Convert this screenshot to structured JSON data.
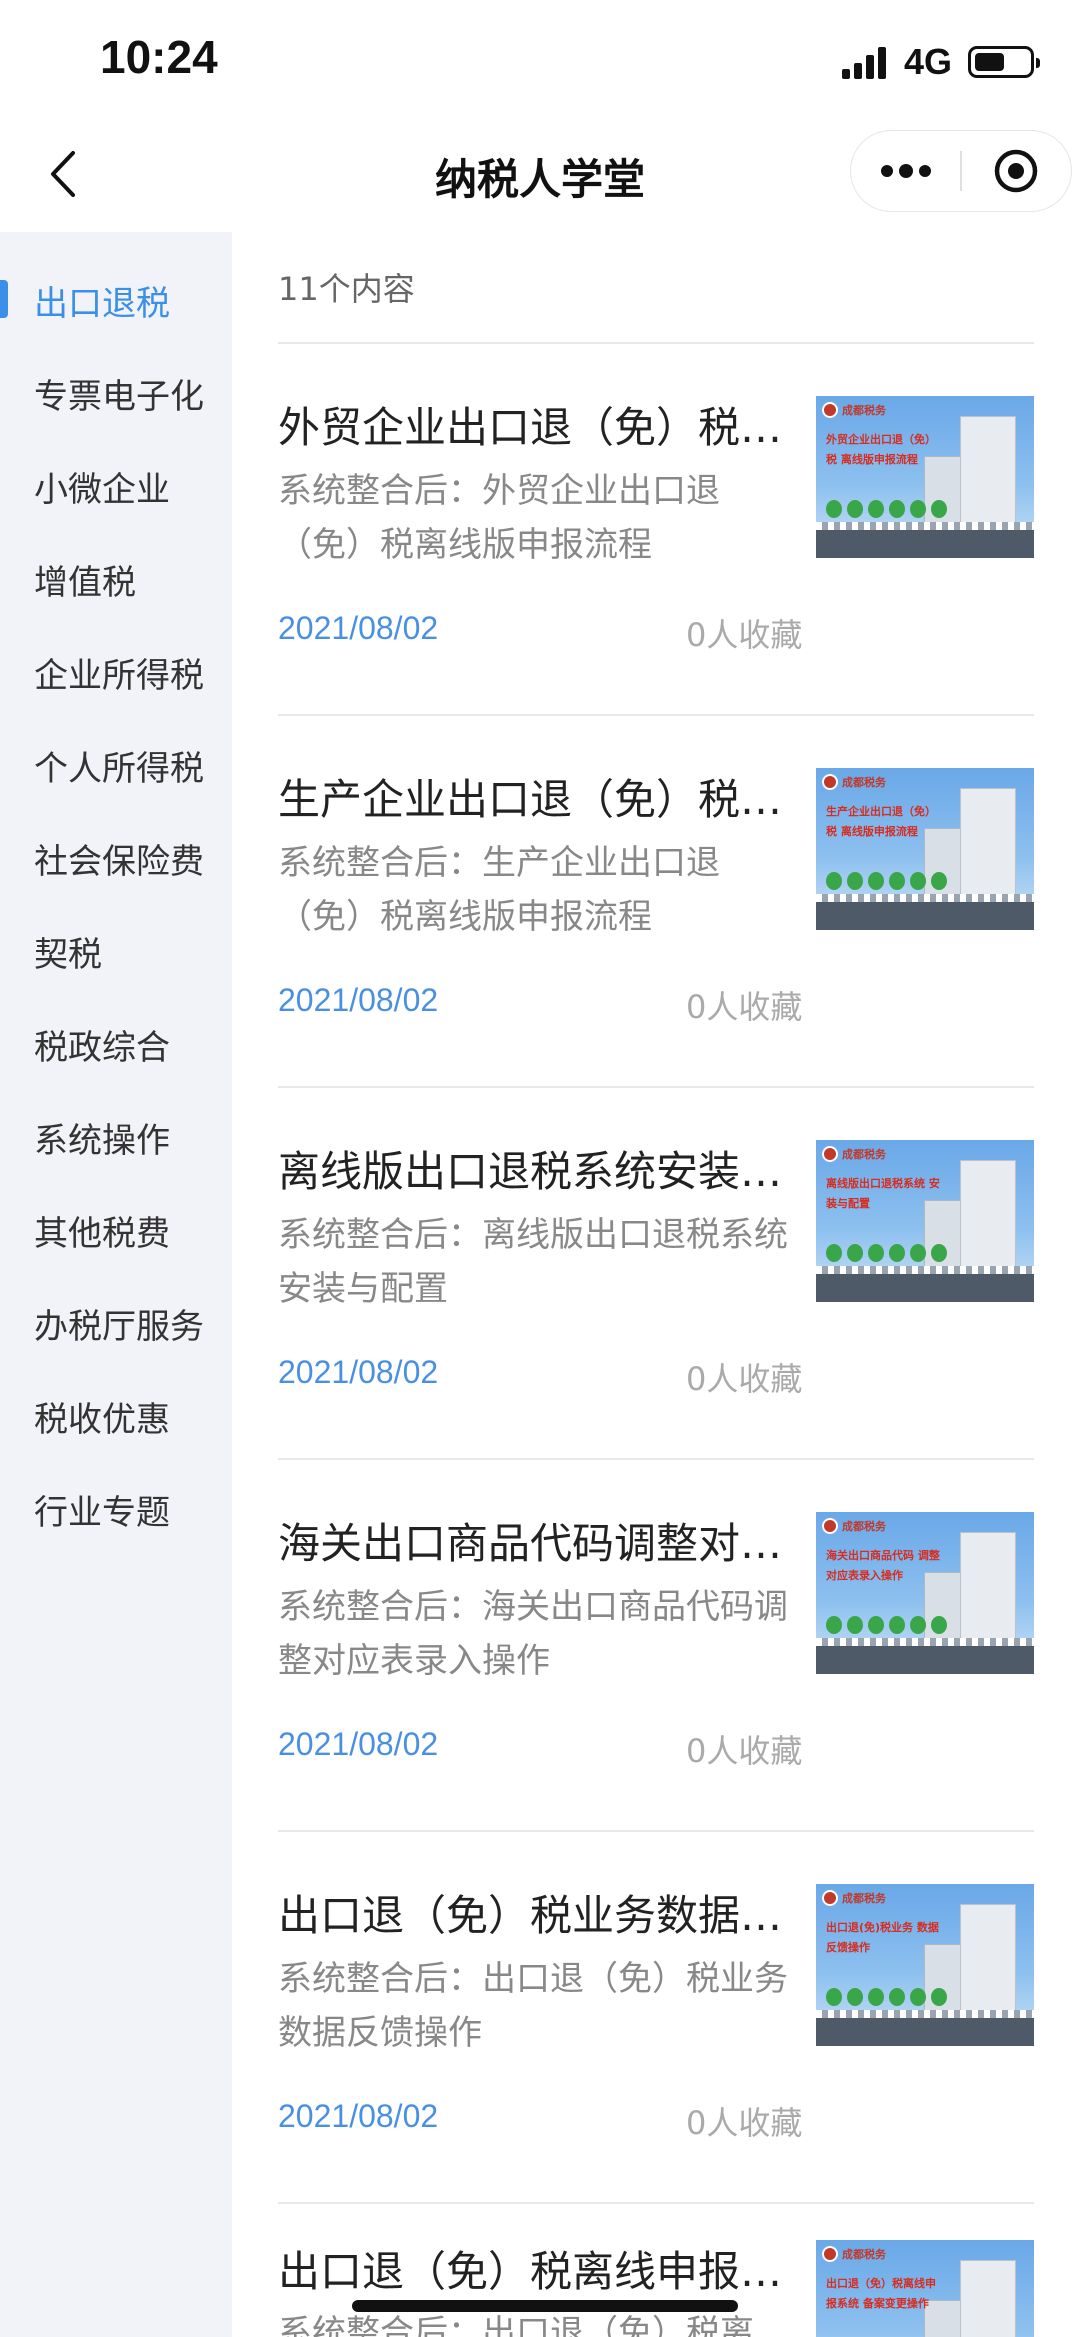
{
  "status_bar": {
    "time": "10:24",
    "network": "4G"
  },
  "nav": {
    "title": "纳税人学堂"
  },
  "sidebar": {
    "items": [
      {
        "label": "出口退税",
        "active": true
      },
      {
        "label": "专票电子化"
      },
      {
        "label": "小微企业"
      },
      {
        "label": "增值税"
      },
      {
        "label": "企业所得税"
      },
      {
        "label": "个人所得税"
      },
      {
        "label": "社会保险费"
      },
      {
        "label": "契税"
      },
      {
        "label": "税政综合"
      },
      {
        "label": "系统操作"
      },
      {
        "label": "其他税费"
      },
      {
        "label": "办税厅服务"
      },
      {
        "label": "税收优惠"
      },
      {
        "label": "行业专题"
      }
    ]
  },
  "content": {
    "count": "11个内容",
    "items": [
      {
        "title": "外贸企业出口退（免）税离线版申报流程",
        "desc": "系统整合后：外贸企业出口退（免）税离线版申报流程",
        "date": "2021/08/02",
        "fav": "0人收藏",
        "thumb_text": "外贸企业出口退（免）税 离线版申报流程"
      },
      {
        "title": "生产企业出口退（免）税离线版申报流程",
        "desc": "系统整合后：生产企业出口退（免）税离线版申报流程",
        "date": "2021/08/02",
        "fav": "0人收藏",
        "thumb_text": "生产企业出口退（免）税 离线版申报流程"
      },
      {
        "title": "离线版出口退税系统安装与配置",
        "desc": "系统整合后：离线版出口退税系统安装与配置",
        "date": "2021/08/02",
        "fav": "0人收藏",
        "thumb_text": "离线版出口退税系统 安装与配置"
      },
      {
        "title": "海关出口商品代码调整对应表录入操作",
        "desc": "系统整合后：海关出口商品代码调整对应表录入操作",
        "date": "2021/08/02",
        "fav": "0人收藏",
        "thumb_text": "海关出口商品代码 调整对应表录入操作"
      },
      {
        "title": "出口退（免）税业务数据反馈操作",
        "desc": "系统整合后：出口退（免）税业务数据反馈操作",
        "date": "2021/08/02",
        "fav": "0人收藏",
        "thumb_text": "出口退(免)税业务 数据反馈操作"
      },
      {
        "title": "出口退（免）税离线申报系统备案变更操作",
        "desc": "系统整合后：出口退（免）税离",
        "date": "",
        "fav": "",
        "thumb_text": "出口退（免）税离线申报系统 备案变更操作"
      }
    ],
    "thumb_logo_text": "成都税务"
  }
}
